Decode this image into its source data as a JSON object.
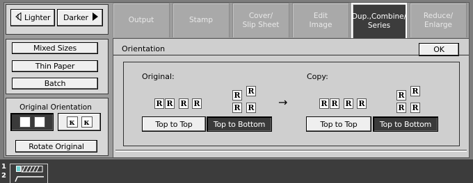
{
  "density": {
    "lighter_label": "Lighter",
    "darker_label": "Darker"
  },
  "left_panel": {
    "mixed_sizes_label": "Mixed Sizes",
    "thin_paper_label": "Thin Paper",
    "batch_label": "Batch",
    "orientation_title": "Original Orientation",
    "orientation_glyph": "R",
    "rotated_glyph": "κ",
    "rotate_label": "Rotate Original"
  },
  "tabs": [
    {
      "label": "Output",
      "active": false
    },
    {
      "label": "Stamp",
      "active": false
    },
    {
      "label": "Cover/\nSlip Sheet",
      "active": false
    },
    {
      "label": "Edit\nImage",
      "active": false
    },
    {
      "label": "Dup.,Combine/\nSeries",
      "active": true
    },
    {
      "label": "Reduce/\nEnlarge",
      "active": false
    }
  ],
  "dialog": {
    "title": "Orientation",
    "ok_label": "OK",
    "original_label": "Original:",
    "copy_label": "Copy:",
    "arrow": "→",
    "page_glyph": "R",
    "original_buttons": [
      {
        "label": "Top to Top",
        "selected": false
      },
      {
        "label": "Top to Bottom",
        "selected": true
      }
    ],
    "copy_buttons": [
      {
        "label": "Top to Top",
        "selected": false
      },
      {
        "label": "Top to Bottom",
        "selected": true
      }
    ]
  },
  "queue": {
    "line1": "1",
    "line2": "2"
  },
  "colors": {
    "panel_bg": "#9c9c9c",
    "content_bg": "#cfcfcf",
    "selected_btn": "#3a3a3a",
    "active_tab": "#3c3c3c"
  }
}
